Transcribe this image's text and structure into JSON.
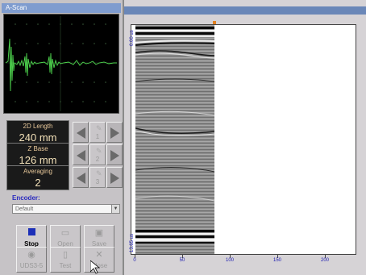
{
  "window": {
    "title": "A-Scan"
  },
  "controls": [
    {
      "label": "2D Length",
      "value": "240 mm",
      "step": "1"
    },
    {
      "label": "Z Base",
      "value": "126 mm",
      "step": "2"
    },
    {
      "label": "Averaging",
      "value": "2",
      "step": "3"
    }
  ],
  "encoder": {
    "label": "Encoder:",
    "value": "Default"
  },
  "toolbar": {
    "stop": "Stop",
    "open": "Open",
    "save": "Save",
    "udsb": "UDS3-5",
    "test": "Test",
    "close": "Close"
  },
  "plot": {
    "y_top": "0.00 us",
    "y_bottom": "13.65 us",
    "x_ticks": [
      "0",
      "50",
      "100",
      "150",
      "200"
    ]
  },
  "colors": {
    "title_bar": "#7f9ccf",
    "ascan_trace": "#4fd84f",
    "control_text": "#f2e0b8",
    "axis_text": "#1a1ab0"
  }
}
